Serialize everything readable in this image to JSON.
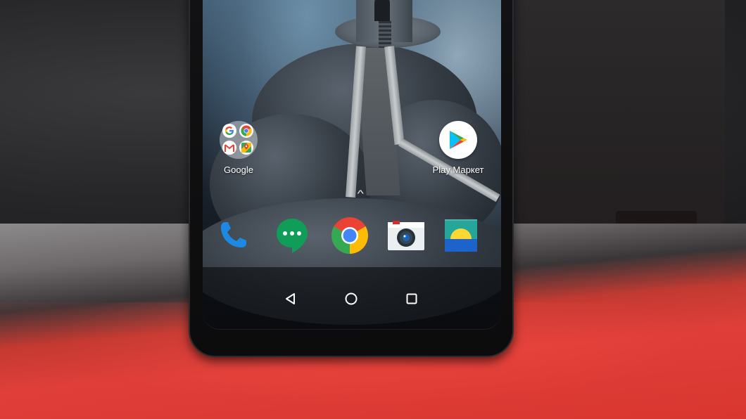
{
  "home_screen": {
    "apps": [
      {
        "id": "google-folder",
        "label": "Google"
      },
      {
        "id": "play-market",
        "label": "Play Маркет"
      }
    ],
    "folder_apps": [
      "G",
      "Chrome",
      "M",
      "Maps"
    ],
    "drawer_hint": "^",
    "dock": [
      {
        "name": "phone",
        "icon": "phone-icon"
      },
      {
        "name": "hangouts",
        "icon": "chat-bubble-icon"
      },
      {
        "name": "chrome",
        "icon": "chrome-icon"
      },
      {
        "name": "camera",
        "icon": "camera-icon"
      },
      {
        "name": "gallery",
        "icon": "gallery-icon"
      }
    ]
  },
  "nav_bar": {
    "back": "back-icon",
    "home": "home-icon",
    "recents": "recents-icon"
  },
  "colors": {
    "google_blue": "#4285F4",
    "google_red": "#EA4335",
    "google_yellow": "#FBBC05",
    "google_green": "#34A853",
    "hangouts_green": "#0F9D58",
    "phone_blue": "#1E88E5",
    "table_red": "#E0403A"
  }
}
